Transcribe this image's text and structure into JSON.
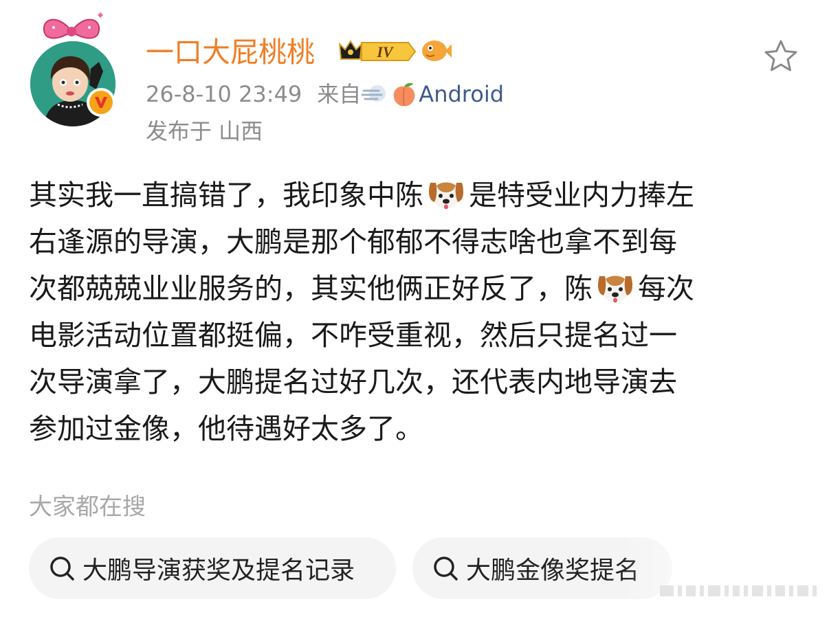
{
  "post": {
    "username": "一口大屁桃桃",
    "vip_level": "IV",
    "timestamp": "26-8-10 23:49",
    "source_prefix": "来自",
    "device": "Android",
    "location": "发布于 山西",
    "body_lines": [
      {
        "a": "其实我一直搞错了，我印象中陈",
        "b": "是特受业内力捧左"
      },
      {
        "a": "右逢源的导演，大鹏是那个郁郁不得志啥也拿不到每"
      },
      {
        "a": "次都兢兢业业服务的，其实他俩正好反了，陈",
        "b": "每次"
      },
      {
        "a": "电影活动位置都挺偏，不咋受重视，然后只提名过一"
      },
      {
        "a": "次导演拿了，大鹏提名过好几次，还代表内地导演去"
      },
      {
        "a": "参加过金像，他待遇好太多了。"
      }
    ]
  },
  "search": {
    "heading": "大家都在搜",
    "chips": [
      "大鹏导演获奖及提名记录",
      "大鹏金像奖提名"
    ]
  },
  "icons": {
    "favorite": "star-outline-icon",
    "verified": "verified-v-icon",
    "dog_emoji": "dog-face-icon",
    "search": "search-icon"
  },
  "colors": {
    "username": "#f07e24",
    "device_link": "#3d5a8a",
    "meta_text": "#8c8c8c",
    "chip_bg": "#f4f4f4"
  }
}
